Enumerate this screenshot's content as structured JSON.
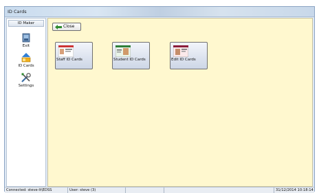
{
  "window": {
    "title": "ID Cards"
  },
  "sidebar": {
    "header": "ID Maker",
    "items": [
      {
        "label": "Exit",
        "icon": "exit-icon"
      },
      {
        "label": "ID Cards",
        "icon": "id-cards-icon"
      },
      {
        "label": "Settings",
        "icon": "settings-icon"
      }
    ]
  },
  "toolbar": {
    "close_label": "Close",
    "close_icon": "back-arrow-icon"
  },
  "cards": [
    {
      "label": "Staff ID Cards"
    },
    {
      "label": "Student ID Cards"
    },
    {
      "label": "Edit ID Cards"
    }
  ],
  "status": {
    "connection": "Connected: steve-lt\\EDSS",
    "user": "User: steve (3)",
    "datetime": "31/12/2014 10:18:14"
  },
  "colors": {
    "content_bg": "#fff8cf",
    "window_bg": "#dfe9f5",
    "accent_green": "#2e8b2e"
  }
}
